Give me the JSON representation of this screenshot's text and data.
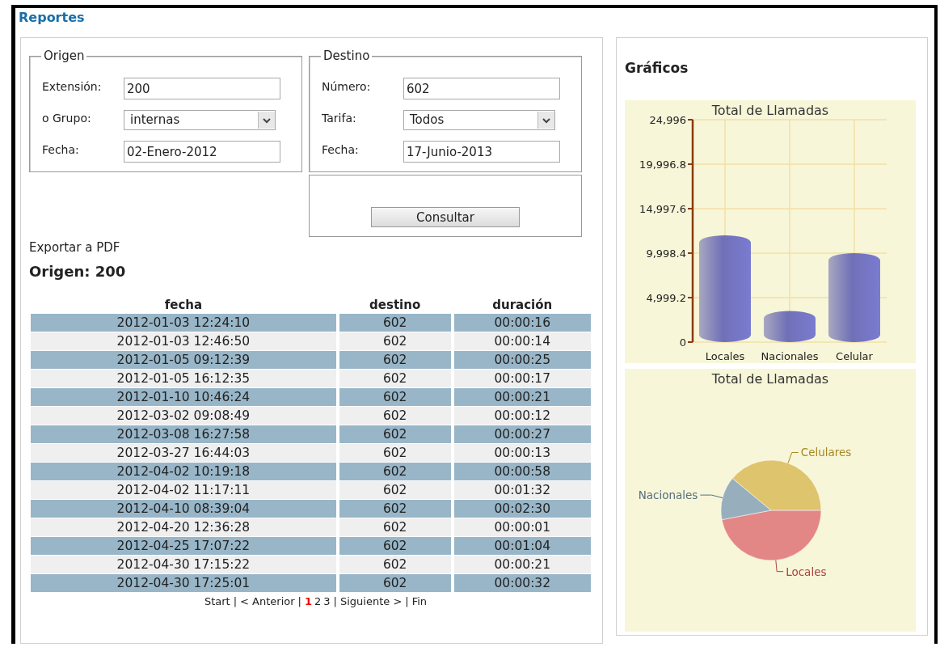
{
  "header": {
    "title": "Reportes"
  },
  "origen": {
    "legend": "Origen",
    "fields": [
      {
        "kind": "input",
        "label": "Extensión:",
        "value": "200"
      },
      {
        "kind": "select",
        "label": "o Grupo:",
        "value": "internas"
      },
      {
        "kind": "input",
        "label": "Fecha:",
        "value": "02-Enero-2012"
      }
    ]
  },
  "destino": {
    "legend": "Destino",
    "fields": [
      {
        "kind": "input",
        "label": "Número:",
        "value": "602"
      },
      {
        "kind": "select",
        "label": "Tarifa:",
        "value": "Todos"
      },
      {
        "kind": "input",
        "label": "Fecha:",
        "value": "17-Junio-2013"
      }
    ]
  },
  "submit": "Consultar",
  "export_link": "Exportar a PDF",
  "result_title": "Origen: 200",
  "table": {
    "columns": [
      "fecha",
      "destino",
      "duración"
    ],
    "rows": [
      [
        "2012-01-03 12:24:10",
        "602",
        "00:00:16"
      ],
      [
        "2012-01-03 12:46:50",
        "602",
        "00:00:14"
      ],
      [
        "2012-01-05 09:12:39",
        "602",
        "00:00:25"
      ],
      [
        "2012-01-05 16:12:35",
        "602",
        "00:00:17"
      ],
      [
        "2012-01-10 10:46:24",
        "602",
        "00:00:21"
      ],
      [
        "2012-03-02 09:08:49",
        "602",
        "00:00:12"
      ],
      [
        "2012-03-08 16:27:58",
        "602",
        "00:00:27"
      ],
      [
        "2012-03-27 16:44:03",
        "602",
        "00:00:13"
      ],
      [
        "2012-04-02 10:19:18",
        "602",
        "00:00:58"
      ],
      [
        "2012-04-02 11:17:11",
        "602",
        "00:01:32"
      ],
      [
        "2012-04-10 08:39:04",
        "602",
        "00:02:30"
      ],
      [
        "2012-04-20 12:36:28",
        "602",
        "00:00:01"
      ],
      [
        "2012-04-25 17:07:22",
        "602",
        "00:01:04"
      ],
      [
        "2012-04-30 17:15:22",
        "602",
        "00:00:21"
      ],
      [
        "2012-04-30 17:25:01",
        "602",
        "00:00:32"
      ]
    ]
  },
  "pagination": {
    "separator": "|",
    "start": "Start",
    "prev": "< Anterior",
    "pages": [
      {
        "label": "1",
        "selected": true
      },
      {
        "label": "2",
        "selected": false
      },
      {
        "label": "3",
        "selected": false
      }
    ],
    "next": "Siguiente >",
    "end": "Fin"
  },
  "charts_title": "Gráficos",
  "bar_chart": {
    "chart_data": {
      "type": "bar",
      "title": "Total de Llamadas",
      "categories": [
        "Locales",
        "Nacionales",
        "Celular"
      ],
      "grid": true,
      "series": [
        {
          "color": "#7b7bd0",
          "values": [
            12000,
            3500,
            10000
          ]
        }
      ],
      "ylim": [
        0,
        24996
      ],
      "yticks": [
        {
          "value": 0,
          "label": "0"
        },
        {
          "value": 4999.2,
          "label": "4,999.2"
        },
        {
          "value": 9998.4,
          "label": "9,998.4"
        },
        {
          "value": 14997.6,
          "label": "14,997.6"
        },
        {
          "value": 19996.8,
          "label": "19,996.8"
        },
        {
          "value": 24996,
          "label": "24,996"
        }
      ]
    }
  },
  "pie_chart": {
    "chart_data": {
      "type": "pie",
      "title": "Total de Llamadas",
      "categories": [
        "Locales",
        "Nacionales",
        "Celulares"
      ],
      "series": [
        {
          "values": [
            47,
            14,
            39
          ]
        }
      ],
      "colors": [
        "#e38686",
        "#97afbd",
        "#dfc46e"
      ]
    }
  }
}
